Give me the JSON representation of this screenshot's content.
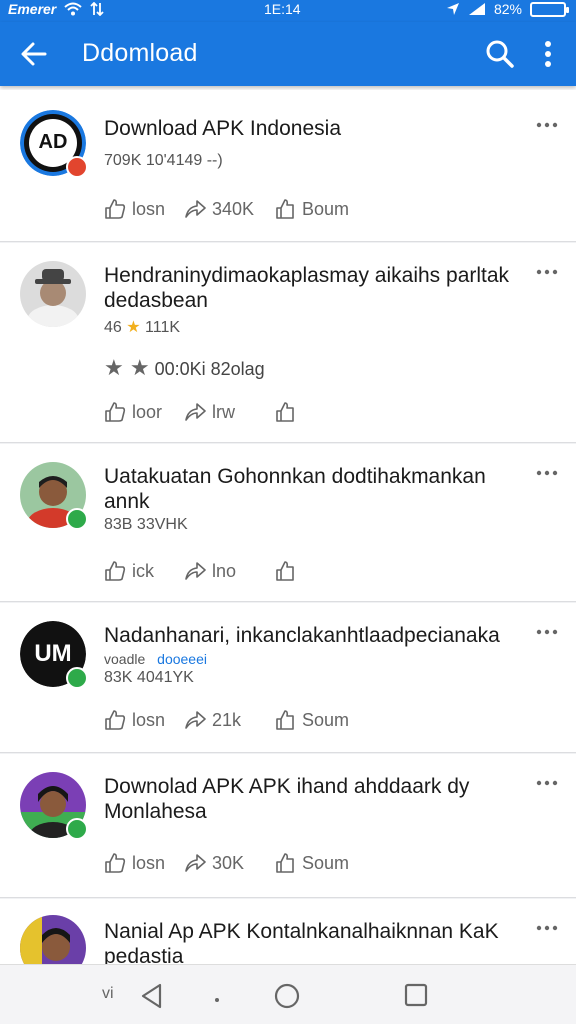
{
  "status_bar": {
    "carrier": "Emerer",
    "time": "1E:14",
    "battery": "82%"
  },
  "app_bar": {
    "title": "Ddomload"
  },
  "posts": [
    {
      "title": "Download APK Indonesia",
      "meta": "709K 10'4149 --)",
      "like": "losn",
      "share": "340K",
      "third": "Boum",
      "avatar_text": "AD",
      "badge_color": "#e2452e"
    },
    {
      "title": "Hendraninydimaokaplasmay aikaihs parltak dedasbean",
      "meta": "46",
      "meta2": "111K",
      "rating": "00:0Ki 82olag",
      "like": "loor",
      "share": "lrw",
      "third": ""
    },
    {
      "title": "Uatakuatan Gohonnkan dodtihakmankan annk",
      "meta": "83B 33VHK",
      "like": "ick",
      "share": "lno",
      "third": "",
      "badge_color": "#2eaa4a"
    },
    {
      "title": "Nadanhanari, inkanclakanhtlaadpecianaka",
      "meta": "voadle",
      "meta_link": "dooeeei",
      "meta_line2": "83K 4041YK",
      "like": "losn",
      "share": "21k",
      "third": "Soum",
      "avatar_text": "UM",
      "badge_color": "#2eaa4a"
    },
    {
      "title": "Downolad APK APK ihand ahddaark dy Monlahesa",
      "meta": "",
      "like": "losn",
      "share": "30K",
      "third": "Soum",
      "badge_color": "#2eaa4a"
    },
    {
      "title": "Nanial Ap APK Kontalnkanalhaiknnan KaK pedastia",
      "meta": ""
    }
  ],
  "nav": {
    "menu": "vi",
    "back": "back-triangle",
    "home": "home-circle",
    "recents": "recents-square"
  }
}
